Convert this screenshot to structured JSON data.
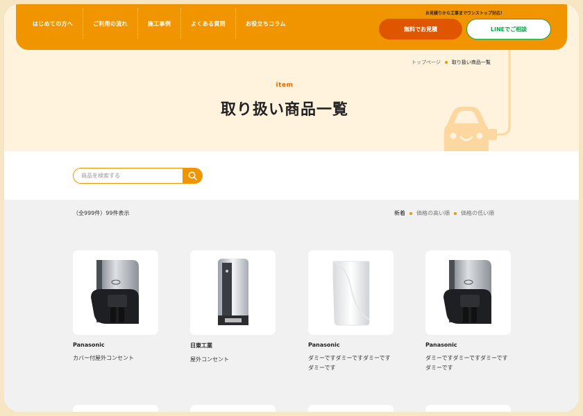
{
  "nav": {
    "items": [
      "はじめての方へ",
      "ご利用の流れ",
      "施工事例",
      "よくある質問",
      "お役立ちコラム"
    ]
  },
  "header": {
    "note": "お見積りから工事までワンストップ対応！",
    "estimate_label": "無料でお見積",
    "line_label": "LINEでご相談"
  },
  "breadcrumb": {
    "home": "トップページ",
    "current": "取り扱い商品一覧"
  },
  "page": {
    "title_en": "item",
    "title_ja": "取り扱い商品一覧"
  },
  "search": {
    "placeholder": "商品を検索する"
  },
  "results": {
    "count_text": "（全999件）99件表示"
  },
  "sort": {
    "options": [
      "新着",
      "価格の高い順",
      "価格の低い順"
    ],
    "active": 0
  },
  "products": [
    {
      "maker": "Panasonic",
      "name": "カバー付屋外コンセント"
    },
    {
      "maker": "日東工業",
      "name": "屋外コンセント"
    },
    {
      "maker": "Panasonic",
      "name": "ダミーですダミーですダミーですダミーです"
    },
    {
      "maker": "Panasonic",
      "name": "ダミーですダミーですダミーですダミーです"
    }
  ],
  "colors": {
    "accent": "#f09400",
    "estimate": "#e05600",
    "line": "#0aa84a",
    "hero_bg": "#fff3de"
  }
}
